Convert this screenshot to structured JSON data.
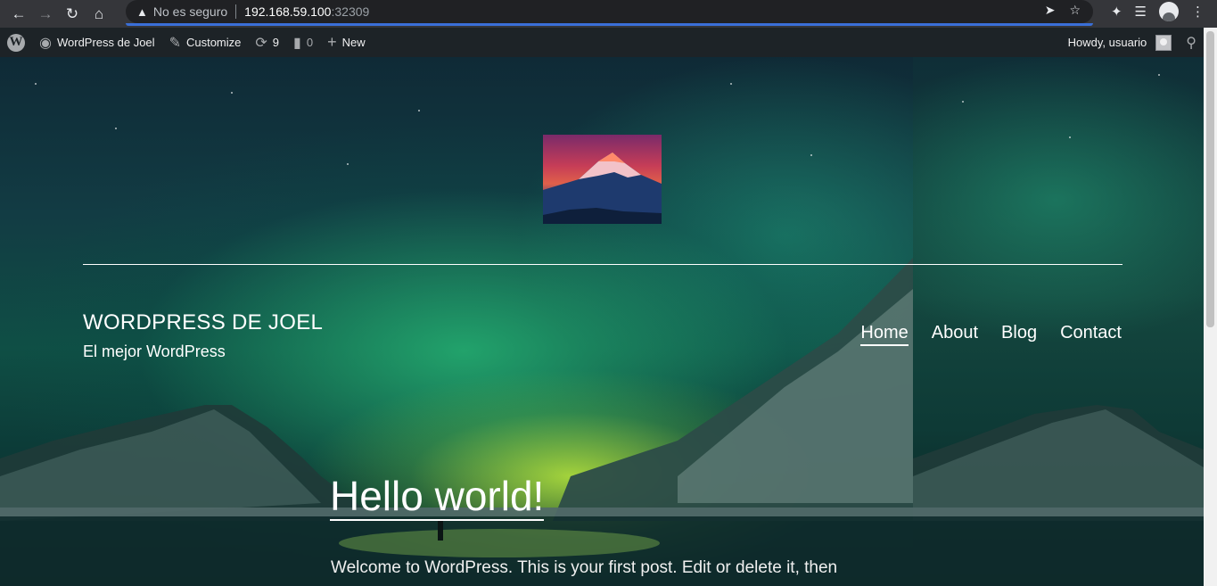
{
  "browser": {
    "address_warning": "No es seguro",
    "url_host": "192.168.59.100",
    "url_port": ":32309",
    "icons": [
      "back-arrow-icon",
      "forward-arrow-icon",
      "reload-icon",
      "home-icon",
      "warning-icon",
      "send-icon",
      "star-icon",
      "puzzle-icon",
      "playlist-icon",
      "profile-icon",
      "kebab-menu-icon"
    ]
  },
  "admin_bar": {
    "site_name": "WordPress de Joel",
    "customize": "Customize",
    "updates_count": "9",
    "comments_count": "0",
    "new_label": "New",
    "howdy": "Howdy, usuario"
  },
  "site": {
    "title": "WORDPRESS DE JOEL",
    "description": "El mejor WordPress"
  },
  "nav": {
    "items": [
      {
        "label": "Home",
        "current": true
      },
      {
        "label": "About",
        "current": false
      },
      {
        "label": "Blog",
        "current": false
      },
      {
        "label": "Contact",
        "current": false
      }
    ]
  },
  "post": {
    "title": "Hello world!",
    "excerpt": "Welcome to WordPress. This is your first post. Edit or delete it, then"
  },
  "colors": {
    "admin_bar_bg": "#1d2327",
    "browser_bar_bg": "#35363a",
    "accent_blue": "#3a6fd8"
  }
}
